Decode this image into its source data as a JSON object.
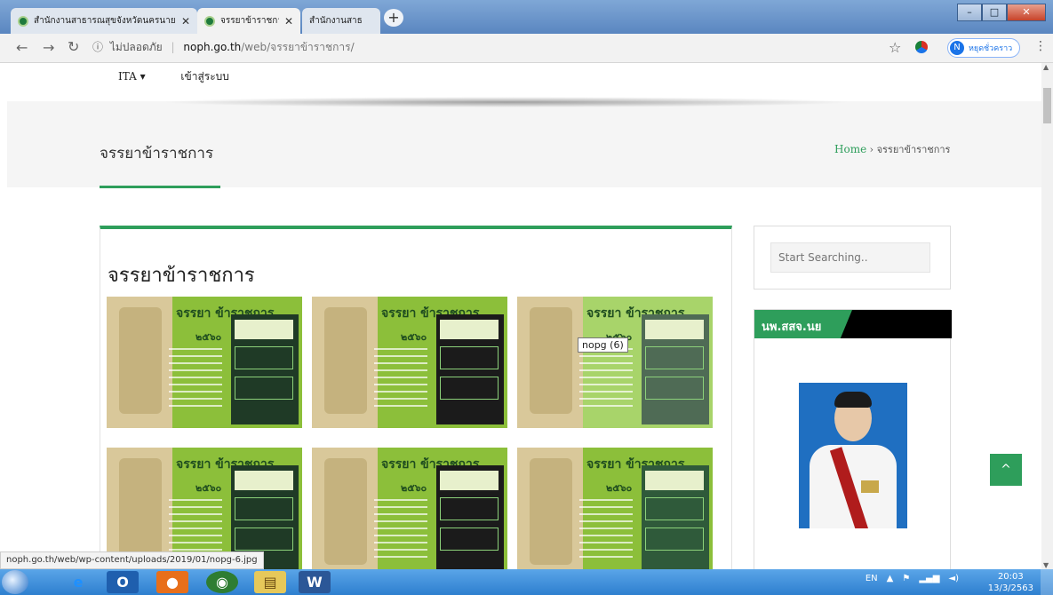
{
  "browser": {
    "tabs": [
      {
        "title": "สำนักงานสาธารณสุขจังหวัดนครนายก",
        "active": false
      },
      {
        "title": "จรรยาข้าราชการ –",
        "active": true
      },
      {
        "title": "สำนักงานสาธ",
        "active": false
      }
    ],
    "new_tab_icon": "+",
    "address": {
      "security_label": "ไม่ปลอดภัย",
      "host": "noph.go.th",
      "path": "/web/จรรยาข้าราชการ/"
    },
    "profile_initial": "N",
    "profile_label": "หยุดชั่วคราว",
    "status_url": "noph.go.th/web/wp-content/uploads/2019/01/nopg-6.jpg"
  },
  "page": {
    "topnav": [
      "ITA ▾",
      "เข้าสู่ระบบ"
    ],
    "title": "จรรยาข้าราชการ",
    "breadcrumb": {
      "home": "Home",
      "separator": "›",
      "current": "จรรยาข้าราชการ"
    },
    "card_title": "จรรยาข้าราชการ",
    "thumbnail_heading": "จรรยา ข้าราชการ",
    "thumbnail_year": "๒๕๖๐",
    "tooltip": "nopg (6)",
    "search_placeholder": "Start Searching..",
    "widget_title": "นพ.สสจ.นย",
    "back_to_top_icon": "^",
    "accent_color": "#2e9e5b"
  },
  "taskbar": {
    "lang": "EN",
    "time": "20:03",
    "date": "13/3/2563",
    "apps": [
      "ie-icon",
      "outlook-icon",
      "firefox-icon",
      "chrome-icon",
      "explorer-icon",
      "word-icon"
    ]
  }
}
